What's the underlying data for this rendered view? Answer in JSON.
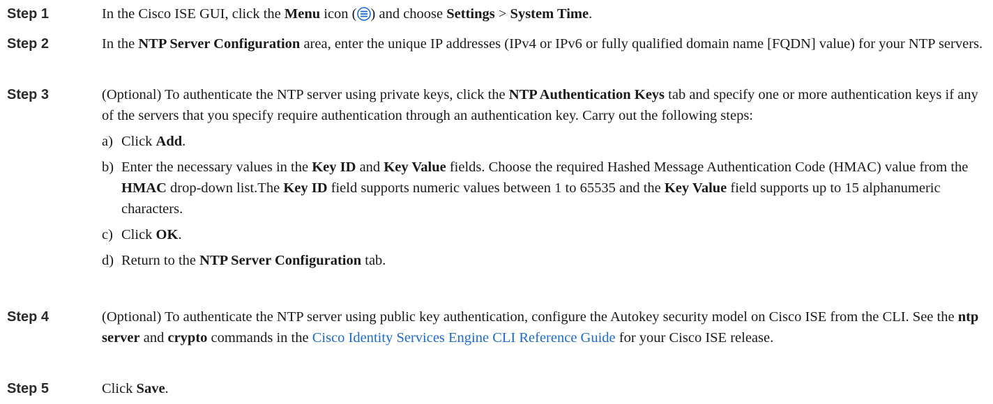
{
  "steps": [
    {
      "label": "Step 1",
      "t1": "In the Cisco ISE GUI, click the ",
      "b1": "Menu",
      "t2": " icon (",
      "t3": ") and choose ",
      "b2": "Settings",
      "t4": " > ",
      "b3": "System Time",
      "t5": ".",
      "icon": "menu-icon"
    },
    {
      "label": "Step 2",
      "t1": "In the ",
      "b1": "NTP Server Configuration",
      "t2": " area, enter the unique IP addresses (IPv4 or IPv6 or fully qualified domain name [FQDN] value) for your NTP servers."
    },
    {
      "label": "Step 3",
      "t1": "(Optional) To authenticate the NTP server using private keys, click the ",
      "b1": "NTP Authentication Keys",
      "t2": " tab and specify one or more authentication keys if any of the servers that you specify require authentication through an authentication key. Carry out the following steps:",
      "subs": [
        {
          "letter": "a)",
          "t1": "Click ",
          "b1": "Add",
          "t2": "."
        },
        {
          "letter": "b)",
          "t1": "Enter the necessary values in the ",
          "b1": "Key ID",
          "t2": " and ",
          "b2": "Key Value",
          "t3": " fields. Choose the required Hashed Message Authentication Code (HMAC) value from the ",
          "b3": "HMAC",
          "t4": " drop-down list.The ",
          "b4": "Key ID",
          "t5": " field supports numeric values between 1 to 65535 and the ",
          "b5": "Key Value",
          "t6": " field supports up to 15 alphanumeric characters."
        },
        {
          "letter": "c)",
          "t1": "Click ",
          "b1": "OK",
          "t2": "."
        },
        {
          "letter": "d)",
          "t1": "Return to the ",
          "b1": "NTP Server Configuration",
          "t2": " tab."
        }
      ]
    },
    {
      "label": "Step 4",
      "t1": "(Optional) To authenticate the NTP server using public key authentication, configure the Autokey security model on Cisco ISE from the CLI. See the ",
      "b1": "ntp server",
      "t2": " and ",
      "b2": "crypto",
      "t3": " commands in the ",
      "link": "Cisco Identity Services Engine CLI Reference Guide",
      "t4": " for your Cisco ISE release."
    },
    {
      "label": "Step 5",
      "t1": "Click ",
      "b1": "Save",
      "t2": "."
    }
  ],
  "colors": {
    "text": "#1a1a1a",
    "label": "#2b2b2b",
    "link": "#1a6ad1",
    "icon": "#1a6ad1"
  }
}
